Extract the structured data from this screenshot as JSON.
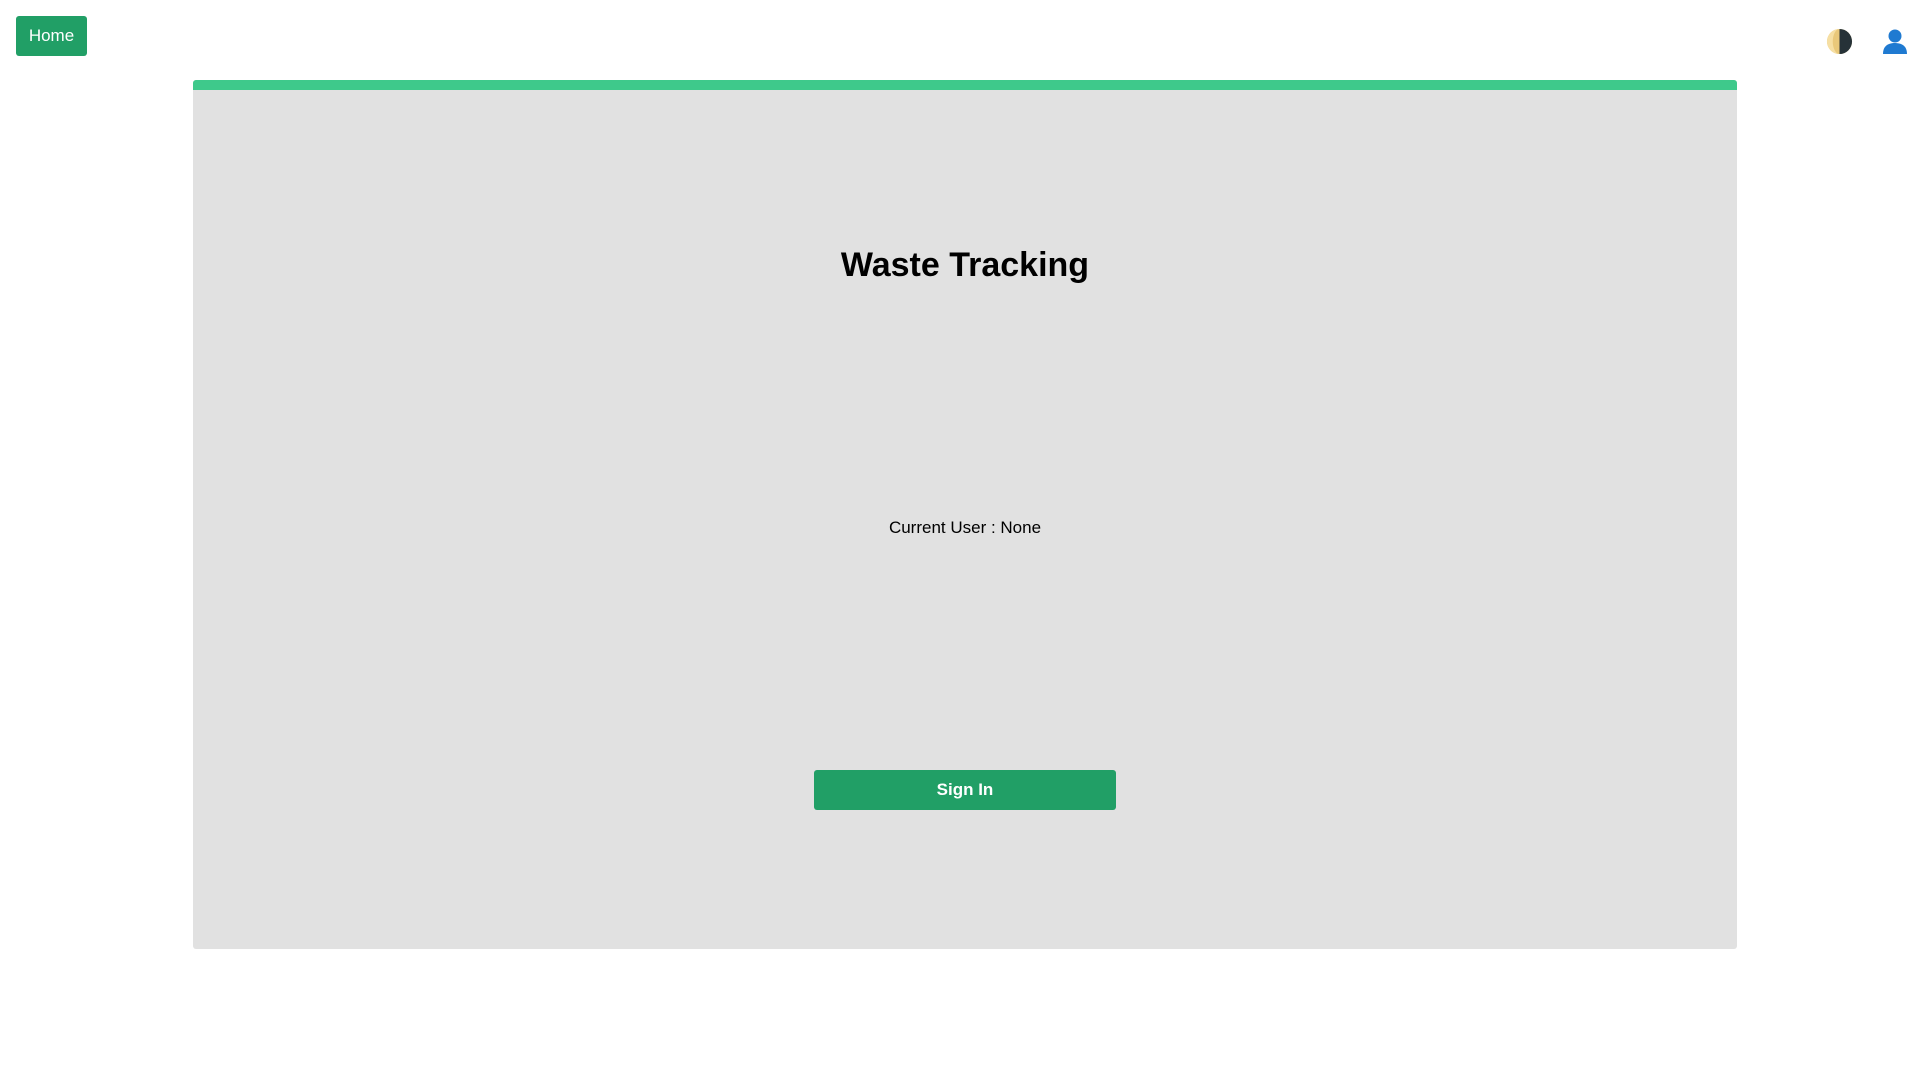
{
  "nav": {
    "home_label": "Home",
    "theme_toggle_icon": "half-moon-theme-icon",
    "user_icon": "user-profile-icon"
  },
  "main": {
    "title": "Waste Tracking",
    "current_user_label": "Current User : None",
    "signin_label": "Sign In"
  },
  "colors": {
    "primary_button": "#219f66",
    "accent_bar": "#3ec98b",
    "card_background": "#e1e1e1",
    "page_background": "#ffffff",
    "user_icon": "#1f7ad1"
  }
}
